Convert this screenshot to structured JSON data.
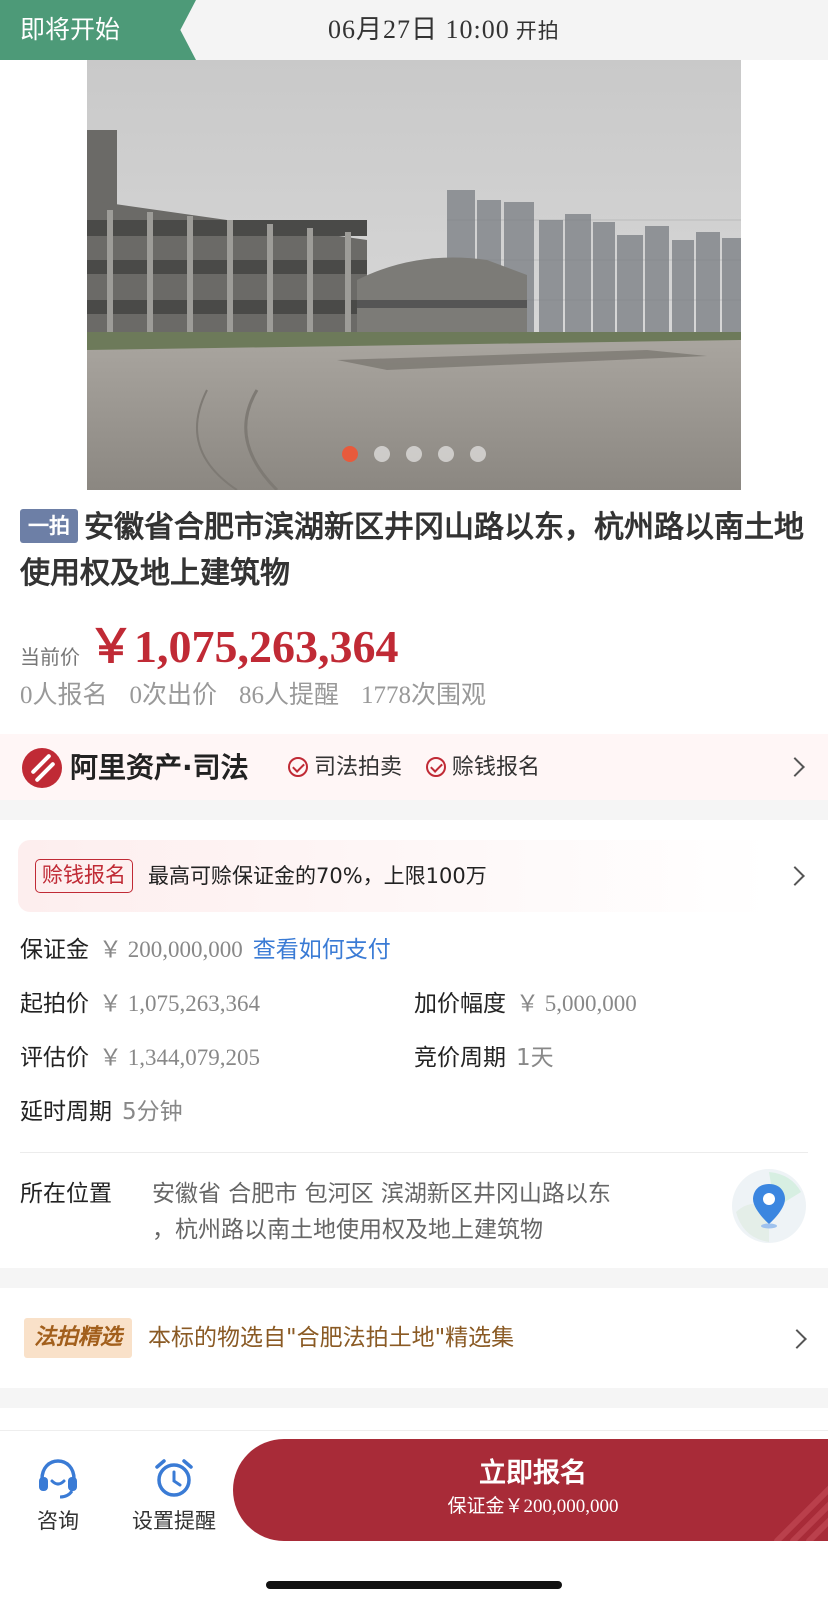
{
  "header": {
    "status": "即将开始",
    "start_time": "06月27日 10:00",
    "start_suffix": "开拍"
  },
  "gallery": {
    "count": 5,
    "active_index": 0
  },
  "lot": {
    "round_tag": "一拍",
    "title": "安徽省合肥市滨湖新区井冈山路以东，杭州路以南土地使用权及地上建筑物",
    "price_label": "当前价",
    "price": "￥1,075,263,364"
  },
  "stats": {
    "signups": "0人报名",
    "bids": "0次出价",
    "reminders": "86人提醒",
    "views": "1778次围观"
  },
  "platform": {
    "name": "阿里资产·司法",
    "feature_1": "司法拍卖",
    "feature_2": "赊钱报名"
  },
  "credit": {
    "tag": "赊钱报名",
    "text": "最高可赊保证金的70%，上限100万"
  },
  "details": {
    "deposit_label": "保证金",
    "deposit_value": "￥ 200,000,000",
    "pay_link": "查看如何支付",
    "start_price_label": "起拍价",
    "start_price_value": "￥ 1,075,263,364",
    "increment_label": "加价幅度",
    "increment_value": "￥ 5,000,000",
    "appraisal_label": "评估价",
    "appraisal_value": "￥ 1,344,079,205",
    "cycle_label": "竞价周期",
    "cycle_value": "1天",
    "delay_label": "延时周期",
    "delay_value": "5分钟",
    "location_label": "所在位置",
    "location_line1": "安徽省 合肥市 包河区 滨湖新区井冈山路以东",
    "location_line2": "，杭州路以南土地使用权及地上建筑物"
  },
  "selection": {
    "tag": "法拍精选",
    "text": "本标的物选自\"合肥法拍土地\"精选集"
  },
  "bottom": {
    "consult": "咨询",
    "reminder": "设置提醒",
    "cta_title": "立即报名",
    "cta_sub": "保证金￥200,000,000"
  },
  "colors": {
    "status_green": "#4d9a78",
    "price_red": "#c02a35",
    "cta_red": "#a82b38",
    "link_blue": "#3a7bd5"
  },
  "icons": [
    "ali-asset-logo-icon",
    "check-circle-icon",
    "chevron-right-icon",
    "map-pin-icon",
    "headset-icon",
    "alarm-clock-icon"
  ]
}
